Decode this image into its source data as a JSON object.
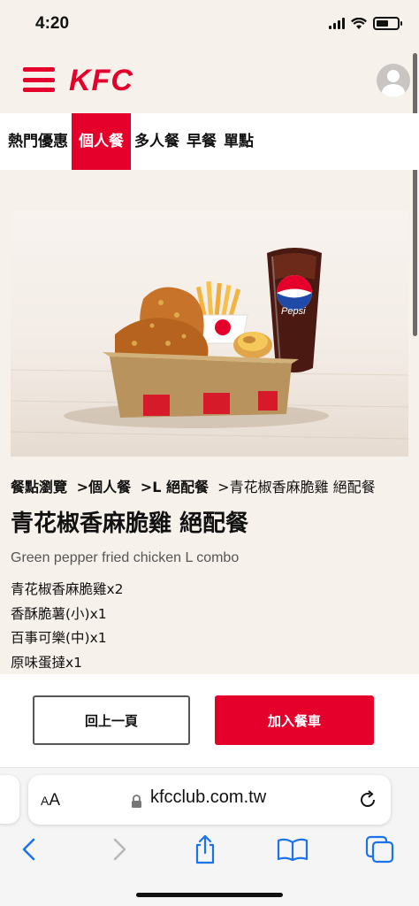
{
  "status_bar": {
    "time": "4:20",
    "battery_level": 0.6
  },
  "header": {
    "logo": "KFC",
    "menu_icon": "hamburger-menu-icon",
    "profile_icon": "user-avatar-icon"
  },
  "tabs": [
    {
      "label": "熱門優惠",
      "active": false
    },
    {
      "label": "個人餐",
      "active": true
    },
    {
      "label": "多人餐",
      "active": false
    },
    {
      "label": "早餐",
      "active": false
    },
    {
      "label": "單點",
      "active": false
    }
  ],
  "product": {
    "image_alt_text": "Pepsi",
    "breadcrumb": {
      "root": "餐點瀏覽",
      "category": "個人餐",
      "subcategory": "L 絕配餐",
      "current": "青花椒香麻脆雞 絕配餐"
    },
    "title": "青花椒香麻脆雞 絕配餐",
    "subtitle": "Green pepper fried chicken L combo",
    "items": [
      "青花椒香麻脆雞x2",
      "香酥脆薯(小)x1",
      "百事可樂(中)x1",
      "原味蛋撻x1"
    ]
  },
  "actions": {
    "back_label": "回上一頁",
    "add_to_cart_label": "加入餐車"
  },
  "browser": {
    "text_size_label_small": "A",
    "text_size_label_large": "A",
    "url": "kfcclub.com.tw",
    "toolbar_icons": [
      "back-icon",
      "forward-icon",
      "share-icon",
      "bookmarks-icon",
      "tabs-icon"
    ]
  },
  "colors": {
    "brand_red": "#e4002b",
    "page_background": "#f7f1ec",
    "safari_blue": "#1a73e8"
  }
}
